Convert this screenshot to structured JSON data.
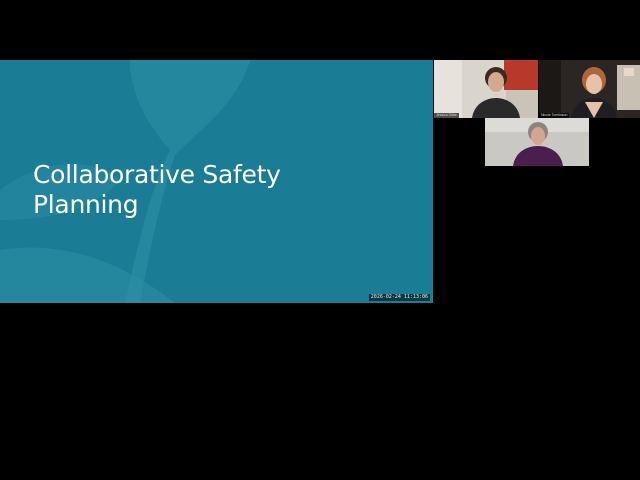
{
  "slide": {
    "title": "Collaborative Safety Planning",
    "timestamp": "2026-02-24 11:13:06"
  },
  "participants": [
    {
      "name": "Jessica Gilbe",
      "tile": "top-left"
    },
    {
      "name": "Nicole Tomlinson",
      "tile": "top-right"
    },
    {
      "name": "",
      "tile": "bottom-center"
    }
  ],
  "colors": {
    "slide_bg": "#1a7d95",
    "slide_shape": "#2e8fa6",
    "background": "#000000"
  }
}
